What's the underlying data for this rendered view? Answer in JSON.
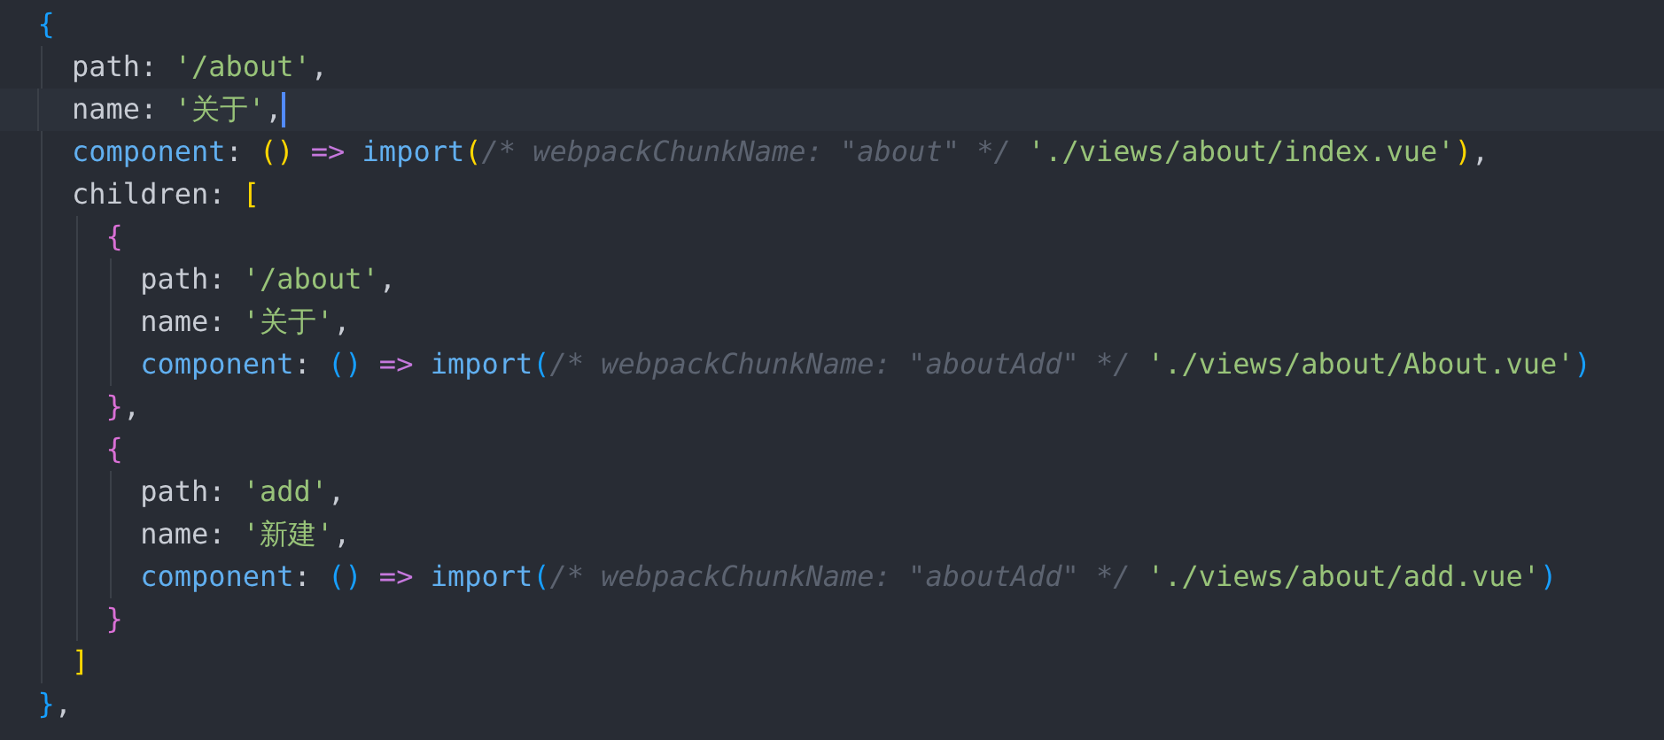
{
  "editor": {
    "lines": [
      {
        "current": false,
        "tokens": [
          {
            "kind": "bracket",
            "text": "  {",
            "color": "#179fff"
          }
        ]
      },
      {
        "current": false,
        "tokens": [
          {
            "kind": "key",
            "text": "    path"
          },
          {
            "kind": "punct",
            "text": ": "
          },
          {
            "kind": "string",
            "text": "'/about'"
          },
          {
            "kind": "punct",
            "text": ","
          }
        ]
      },
      {
        "current": true,
        "tokens": [
          {
            "kind": "key",
            "text": "    name"
          },
          {
            "kind": "punct",
            "text": ": "
          },
          {
            "kind": "string",
            "text": "'关于'"
          },
          {
            "kind": "punct",
            "text": ","
          }
        ]
      },
      {
        "current": false,
        "tokens": [
          {
            "kind": "prop",
            "text": "    component"
          },
          {
            "kind": "punct",
            "text": ": "
          },
          {
            "kind": "bracket",
            "text": "()",
            "color": "#ffd700"
          },
          {
            "kind": "arrow",
            "text": " => "
          },
          {
            "kind": "func",
            "text": "import"
          },
          {
            "kind": "bracket",
            "text": "(",
            "color": "#ffd700"
          },
          {
            "kind": "comment",
            "text": "/* webpackChunkName: \"about\" */ "
          },
          {
            "kind": "string",
            "text": "'./views/about/index.vue'"
          },
          {
            "kind": "bracket",
            "text": ")",
            "color": "#ffd700"
          },
          {
            "kind": "punct",
            "text": ","
          }
        ]
      },
      {
        "current": false,
        "tokens": [
          {
            "kind": "key",
            "text": "    children"
          },
          {
            "kind": "punct",
            "text": ": "
          },
          {
            "kind": "bracket",
            "text": "[",
            "color": "#ffd700"
          }
        ]
      },
      {
        "current": false,
        "tokens": [
          {
            "kind": "bracket",
            "text": "      {",
            "color": "#da70d6"
          }
        ]
      },
      {
        "current": false,
        "tokens": [
          {
            "kind": "key",
            "text": "        path"
          },
          {
            "kind": "punct",
            "text": ": "
          },
          {
            "kind": "string",
            "text": "'/about'"
          },
          {
            "kind": "punct",
            "text": ","
          }
        ]
      },
      {
        "current": false,
        "tokens": [
          {
            "kind": "key",
            "text": "        name"
          },
          {
            "kind": "punct",
            "text": ": "
          },
          {
            "kind": "string",
            "text": "'关于'"
          },
          {
            "kind": "punct",
            "text": ","
          }
        ]
      },
      {
        "current": false,
        "tokens": [
          {
            "kind": "prop",
            "text": "        component"
          },
          {
            "kind": "punct",
            "text": ": "
          },
          {
            "kind": "bracket",
            "text": "()",
            "color": "#179fff"
          },
          {
            "kind": "arrow",
            "text": " => "
          },
          {
            "kind": "func",
            "text": "import"
          },
          {
            "kind": "bracket",
            "text": "(",
            "color": "#179fff"
          },
          {
            "kind": "comment",
            "text": "/* webpackChunkName: \"aboutAdd\" */ "
          },
          {
            "kind": "string",
            "text": "'./views/about/About.vue'"
          },
          {
            "kind": "bracket",
            "text": ")",
            "color": "#179fff"
          }
        ]
      },
      {
        "current": false,
        "tokens": [
          {
            "kind": "bracket",
            "text": "      }",
            "color": "#da70d6"
          },
          {
            "kind": "punct",
            "text": ","
          }
        ]
      },
      {
        "current": false,
        "tokens": [
          {
            "kind": "bracket",
            "text": "      {",
            "color": "#da70d6"
          }
        ]
      },
      {
        "current": false,
        "tokens": [
          {
            "kind": "key",
            "text": "        path"
          },
          {
            "kind": "punct",
            "text": ": "
          },
          {
            "kind": "string",
            "text": "'add'"
          },
          {
            "kind": "punct",
            "text": ","
          }
        ]
      },
      {
        "current": false,
        "tokens": [
          {
            "kind": "key",
            "text": "        name"
          },
          {
            "kind": "punct",
            "text": ": "
          },
          {
            "kind": "string",
            "text": "'新建'"
          },
          {
            "kind": "punct",
            "text": ","
          }
        ]
      },
      {
        "current": false,
        "tokens": [
          {
            "kind": "prop",
            "text": "        component"
          },
          {
            "kind": "punct",
            "text": ": "
          },
          {
            "kind": "bracket",
            "text": "()",
            "color": "#179fff"
          },
          {
            "kind": "arrow",
            "text": " => "
          },
          {
            "kind": "func",
            "text": "import"
          },
          {
            "kind": "bracket",
            "text": "(",
            "color": "#179fff"
          },
          {
            "kind": "comment",
            "text": "/* webpackChunkName: \"aboutAdd\" */ "
          },
          {
            "kind": "string",
            "text": "'./views/about/add.vue'"
          },
          {
            "kind": "bracket",
            "text": ")",
            "color": "#179fff"
          }
        ]
      },
      {
        "current": false,
        "tokens": [
          {
            "kind": "bracket",
            "text": "      }",
            "color": "#da70d6"
          }
        ]
      },
      {
        "current": false,
        "tokens": [
          {
            "kind": "bracket",
            "text": "    ]",
            "color": "#ffd700"
          }
        ]
      },
      {
        "current": false,
        "tokens": [
          {
            "kind": "bracket",
            "text": "  }",
            "color": "#179fff"
          },
          {
            "kind": "punct",
            "text": ","
          }
        ]
      }
    ]
  }
}
